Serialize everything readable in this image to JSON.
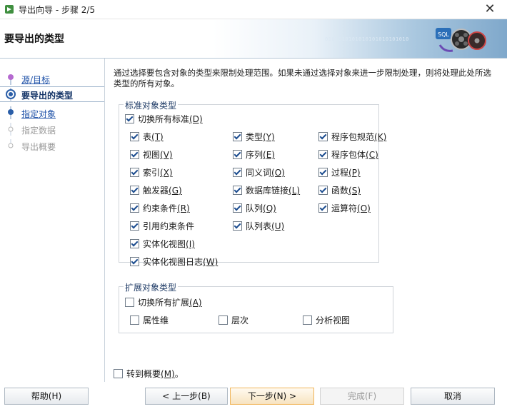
{
  "window": {
    "title": "导出向导 - 步骤 2/5",
    "close_glyph": "✕"
  },
  "header": {
    "title": "要导出的类型",
    "bits": "0101010101010101010101010"
  },
  "sidebar": {
    "steps": [
      {
        "label": "源/目标",
        "state": "done"
      },
      {
        "label": "要导出的类型",
        "state": "current"
      },
      {
        "label": "指定对象",
        "state": "link"
      },
      {
        "label": "指定数据",
        "state": "disabled"
      },
      {
        "label": "导出概要",
        "state": "disabled"
      }
    ]
  },
  "intro": "通过选择要包含对象的类型来限制处理范围。如果未通过选择对象来进一步限制处理，则将处理此处所选类型的所有对象。",
  "standard": {
    "legend": "标准对象类型",
    "toggle_all": {
      "label": "切换所有标准",
      "key": "(D)",
      "checked": true
    },
    "col1": [
      {
        "label": "表",
        "key": "(T)",
        "checked": true
      },
      {
        "label": "视图",
        "key": "(V)",
        "checked": true
      },
      {
        "label": "索引",
        "key": "(X)",
        "checked": true
      },
      {
        "label": "触发器",
        "key": "(G)",
        "checked": true
      },
      {
        "label": "约束条件",
        "key": "(R)",
        "checked": true
      },
      {
        "label": "引用约束条件",
        "key": "",
        "checked": true
      },
      {
        "label": "实体化视图",
        "key": "(I)",
        "checked": true
      },
      {
        "label": "实体化视图日志",
        "key": "(W)",
        "checked": true
      }
    ],
    "col2": [
      {
        "label": "类型",
        "key": "(Y)",
        "checked": true
      },
      {
        "label": "序列",
        "key": "(E)",
        "checked": true
      },
      {
        "label": "同义词",
        "key": "(O)",
        "checked": true
      },
      {
        "label": "数据库链接",
        "key": "(L)",
        "checked": true
      },
      {
        "label": "队列",
        "key": "(Q)",
        "checked": true
      },
      {
        "label": "队列表",
        "key": "(U)",
        "checked": true
      }
    ],
    "col3": [
      {
        "label": "程序包规范",
        "key": "(K)",
        "checked": true
      },
      {
        "label": "程序包体",
        "key": "(C)",
        "checked": true
      },
      {
        "label": "过程",
        "key": "(P)",
        "checked": true
      },
      {
        "label": "函数",
        "key": "(S)",
        "checked": true
      },
      {
        "label": "运算符",
        "key": "(O)",
        "checked": true
      }
    ]
  },
  "extended": {
    "legend": "扩展对象类型",
    "toggle_all": {
      "label": "切换所有扩展",
      "key": "(A)",
      "checked": false
    },
    "items": [
      {
        "label": "属性维",
        "key": "",
        "checked": false
      },
      {
        "label": "层次",
        "key": "",
        "checked": false
      },
      {
        "label": "分析视图",
        "key": "",
        "checked": false
      }
    ]
  },
  "goto_summary": {
    "label": "转到概要",
    "key": "(M)",
    "suffix": "。",
    "checked": false
  },
  "buttons": {
    "help": "帮助(H)",
    "back": "< 上一步(B)",
    "next": "下一步(N) >",
    "finish": "完成(F)",
    "cancel": "取消"
  }
}
